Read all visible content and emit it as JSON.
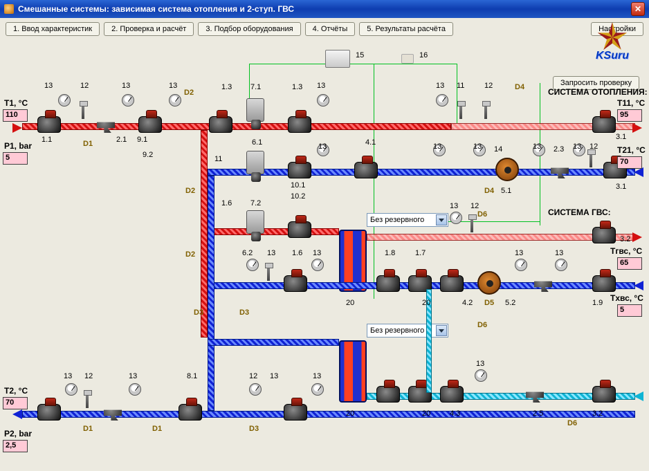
{
  "window": {
    "title": "Смешанные системы: зависимая система отопления и 2-ступ. ГВС"
  },
  "toolbar": {
    "b1": "1. Ввод характеристик",
    "b2": "2. Проверка и расчёт",
    "b3": "3. Подбор оборудования",
    "b4": "4. Отчёты",
    "b5": "5. Результаты расчёта",
    "settings": "Настройки",
    "request_check": "Запросить проверку"
  },
  "logo_text": "KSuru",
  "systems": {
    "heating": "СИСТЕМА ОТОПЛЕНИЯ:",
    "dhw": "СИСТЕМА ГВС:"
  },
  "combos": {
    "c1": "Без резервного",
    "c2": "Без резервного"
  },
  "params": {
    "T1": {
      "label": "T1, °C",
      "value": "110"
    },
    "P1": {
      "label": "P1, bar",
      "value": "5"
    },
    "T2": {
      "label": "T2, °C",
      "value": "70"
    },
    "P2": {
      "label": "P2, bar",
      "value": "2,5"
    },
    "T11": {
      "label": "T11, °C",
      "value": "95"
    },
    "T21": {
      "label": "T21, °C",
      "value": "70"
    },
    "Tg": {
      "label": "Tгвс, °C",
      "value": "65"
    },
    "Tx": {
      "label": "Tхвс, °C",
      "value": "5"
    }
  },
  "tags": {
    "n11": "1.1",
    "n21": "2.1",
    "n91": "9.1",
    "n92": "9.2",
    "n13a": "1.3",
    "n71": "7.1",
    "n13b": "1.3",
    "n61": "6.1",
    "n41": "4.1",
    "n101": "10.1",
    "n102": "10.2",
    "n72": "7.2",
    "n16": "1.6",
    "n62": "6.2",
    "n16b": "1.6",
    "n18": "1.8",
    "n17": "1.7",
    "n42": "4.2",
    "n52": "5.2",
    "n25": "2.5",
    "n19": "1.9",
    "n51": "5.1",
    "n23": "2.3",
    "n31": "3.1",
    "n31b": "3.1",
    "n32": "3.2",
    "n32b": "3.2",
    "n81": "8.1",
    "n43": "4.3",
    "g13": "13",
    "g12": "12",
    "g11": "11",
    "g14": "14",
    "g15": "15",
    "g16": "16",
    "g20": "20",
    "D1": "D1",
    "D2": "D2",
    "D3": "D3",
    "D4": "D4",
    "D5": "D5",
    "D6": "D6"
  }
}
